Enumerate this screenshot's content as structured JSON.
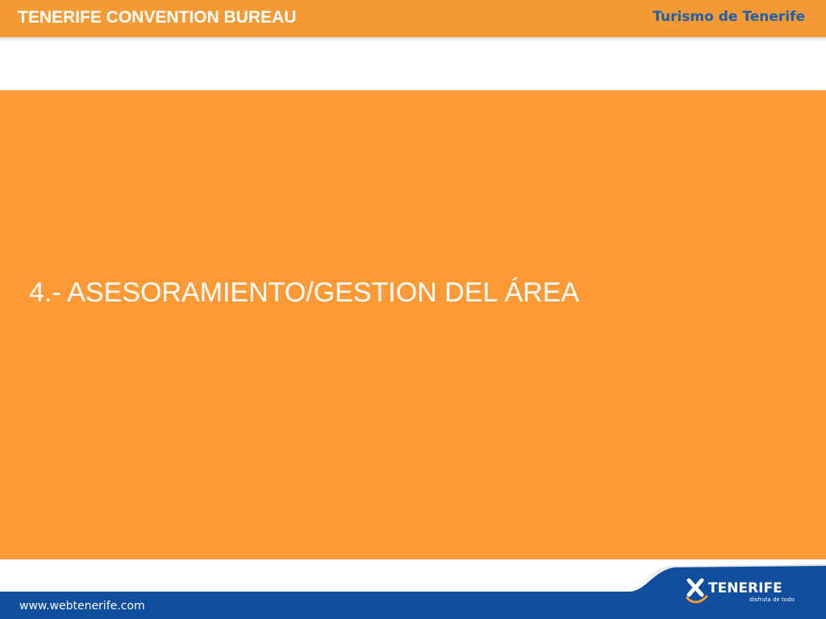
{
  "header": {
    "title": "TENERIFE CONVENTION BUREAU",
    "brand": "Turismo de Tenerife",
    "bar_color": "#f39a35",
    "brand_color": "#1f5ea8"
  },
  "main": {
    "heading": "4.- ASESORAMIENTO/GESTION DEL ÁREA",
    "panel_color": "#fd9a36"
  },
  "footer": {
    "website": "www.webtenerife.com",
    "logo_text": "TENERIFE",
    "logo_tagline": "disfruta de todo",
    "logo_icon": "x-swoosh-icon",
    "band_color": "#0f4e9e"
  }
}
